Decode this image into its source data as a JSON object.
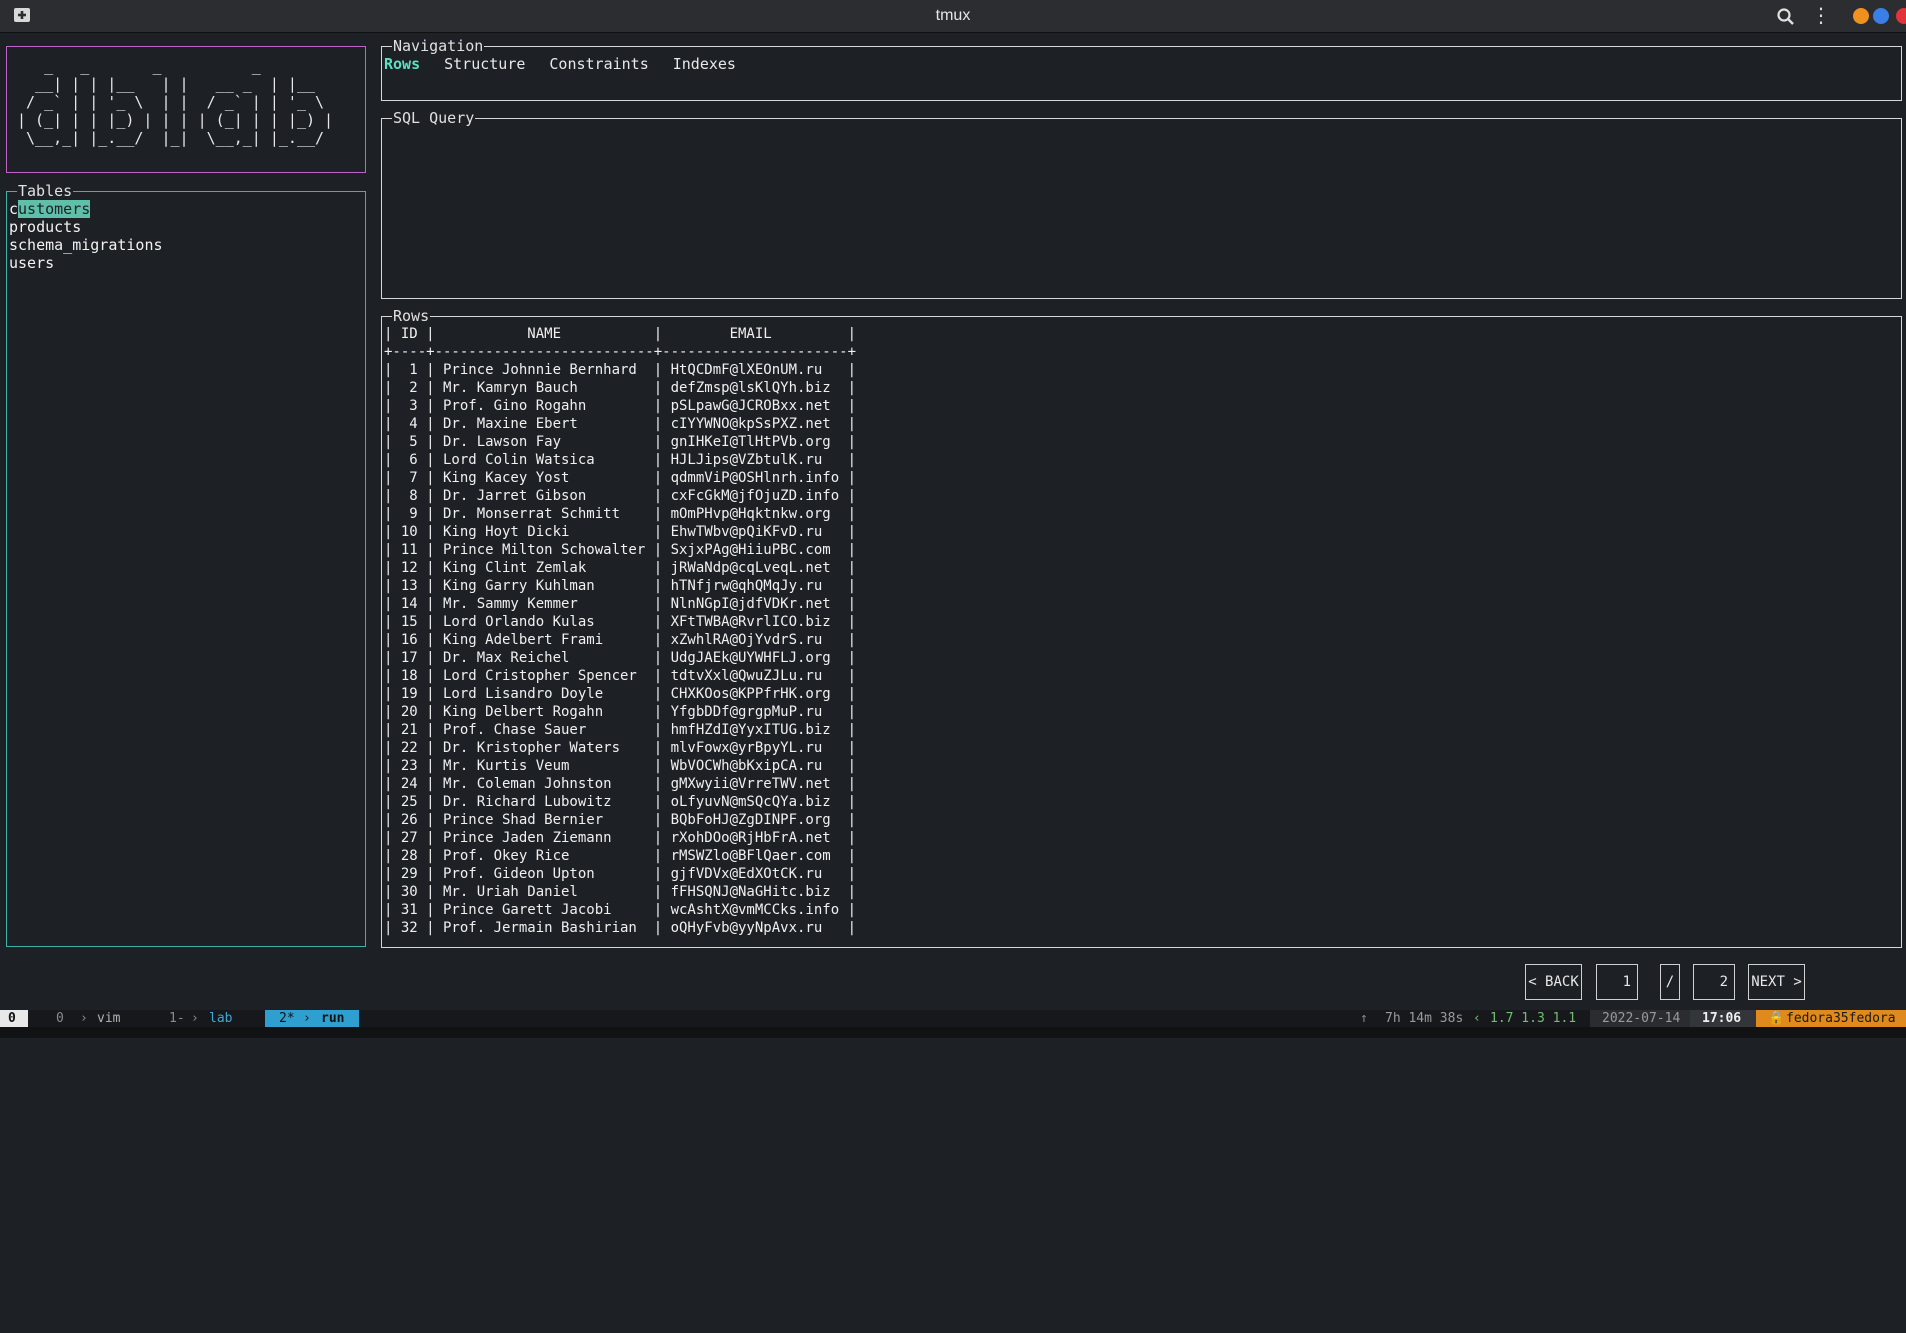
{
  "window": {
    "title": "tmux"
  },
  "logo": {
    "ascii": "   _   _       _          _\n  __| | | |__   | |   __ _  | |__\n / _` | | '_ \\  | |  / _` | | '_ \\\n| (_| | | |_) | | | | (_| | | |_) |\n \\__,_| |_.__/  |_|  \\__,_| |_.__/"
  },
  "tables": {
    "title": "Tables",
    "selected_first": "c",
    "selected_rest": "ustomers",
    "items": [
      "products",
      "schema_migrations",
      "users"
    ]
  },
  "navigation": {
    "title": "Navigation",
    "tabs": [
      "Rows",
      "Structure",
      "Constraints",
      "Indexes"
    ],
    "active": "Rows"
  },
  "sql": {
    "title": "SQL Query",
    "value": ""
  },
  "rows": {
    "title": "Rows",
    "columns": [
      "ID",
      "NAME",
      "EMAIL"
    ],
    "data": [
      [
        1,
        "Prince Johnnie Bernhard",
        "HtQCDmF@lXEOnUM.ru"
      ],
      [
        2,
        "Mr. Kamryn Bauch",
        "defZmsp@lsKlQYh.biz"
      ],
      [
        3,
        "Prof. Gino Rogahn",
        "pSLpawG@JCROBxx.net"
      ],
      [
        4,
        "Dr. Maxine Ebert",
        "cIYYWNO@kpSsPXZ.net"
      ],
      [
        5,
        "Dr. Lawson Fay",
        "gnIHKeI@TlHtPVb.org"
      ],
      [
        6,
        "Lord Colin Watsica",
        "HJLJips@VZbtulK.ru"
      ],
      [
        7,
        "King Kacey Yost",
        "qdmmViP@OSHlnrh.info"
      ],
      [
        8,
        "Dr. Jarret Gibson",
        "cxFcGkM@jfOjuZD.info"
      ],
      [
        9,
        "Dr. Monserrat Schmitt",
        "mOmPHvp@Hqktnkw.org"
      ],
      [
        10,
        "King Hoyt Dicki",
        "EhwTWbv@pQiKFvD.ru"
      ],
      [
        11,
        "Prince Milton Schowalter",
        "SxjxPAg@HiiuPBC.com"
      ],
      [
        12,
        "King Clint Zemlak",
        "jRWaNdp@cqLveqL.net"
      ],
      [
        13,
        "King Garry Kuhlman",
        "hTNfjrw@qhQMqJy.ru"
      ],
      [
        14,
        "Mr. Sammy Kemmer",
        "NlnNGpI@jdfVDKr.net"
      ],
      [
        15,
        "Lord Orlando Kulas",
        "XFtTWBA@RvrlICO.biz"
      ],
      [
        16,
        "King Adelbert Frami",
        "xZwhlRA@OjYvdrS.ru"
      ],
      [
        17,
        "Dr. Max Reichel",
        "UdgJAEk@UYWHFLJ.org"
      ],
      [
        18,
        "Lord Cristopher Spencer",
        "tdtvXxl@QwuZJLu.ru"
      ],
      [
        19,
        "Lord Lisandro Doyle",
        "CHXKOos@KPPfrHK.org"
      ],
      [
        20,
        "King Delbert Rogahn",
        "YfgbDDf@grgpMuP.ru"
      ],
      [
        21,
        "Prof. Chase Sauer",
        "hmfHZdI@YyxITUG.biz"
      ],
      [
        22,
        "Dr. Kristopher Waters",
        "mlvFowx@yrBpyYL.ru"
      ],
      [
        23,
        "Mr. Kurtis Veum",
        "WbVOCWh@bKxipCA.ru"
      ],
      [
        24,
        "Mr. Coleman Johnston",
        "gMXwyii@VrreTWV.net"
      ],
      [
        25,
        "Dr. Richard Lubowitz",
        "oLfyuvN@mSQcQYa.biz"
      ],
      [
        26,
        "Prince Shad Bernier",
        "BQbFoHJ@ZgDINPF.org"
      ],
      [
        27,
        "Prince Jaden Ziemann",
        "rXohDOo@RjHbFrA.net"
      ],
      [
        28,
        "Prof. Okey Rice",
        "rMSWZlo@BFlQaer.com"
      ],
      [
        29,
        "Prof. Gideon Upton",
        "gjfVDVx@EdXOtCK.ru"
      ],
      [
        30,
        "Mr. Uriah Daniel",
        "fFHSQNJ@NaGHitc.biz"
      ],
      [
        31,
        "Prince Garett Jacobi",
        "wcAshtX@vmMCCks.info"
      ],
      [
        32,
        "Prof. Jermain Bashirian",
        "oQHyFvb@yyNpAvx.ru"
      ]
    ]
  },
  "pager": {
    "back_label": "< BACK",
    "current": "1",
    "separator": "/",
    "total": "2",
    "next_label": "NEXT >"
  },
  "statusbar": {
    "session": "0",
    "win0": "0",
    "win0_name": "vim",
    "win1": "1-",
    "win1_name": "lab",
    "win2": "2*",
    "win2_name": "run",
    "uptime": "7h 14m 38s",
    "load": "1.7 1.3 1.1",
    "date": "2022-07-14",
    "time": "17:06",
    "host": "fedora35fedora"
  },
  "colors": {
    "logo_border": "#c065c8",
    "tables_border": "#3fb2a8",
    "active_tab": "#5fe0c0",
    "status_accent": "#3fa7d6",
    "host_bg": "#e08a1e"
  }
}
